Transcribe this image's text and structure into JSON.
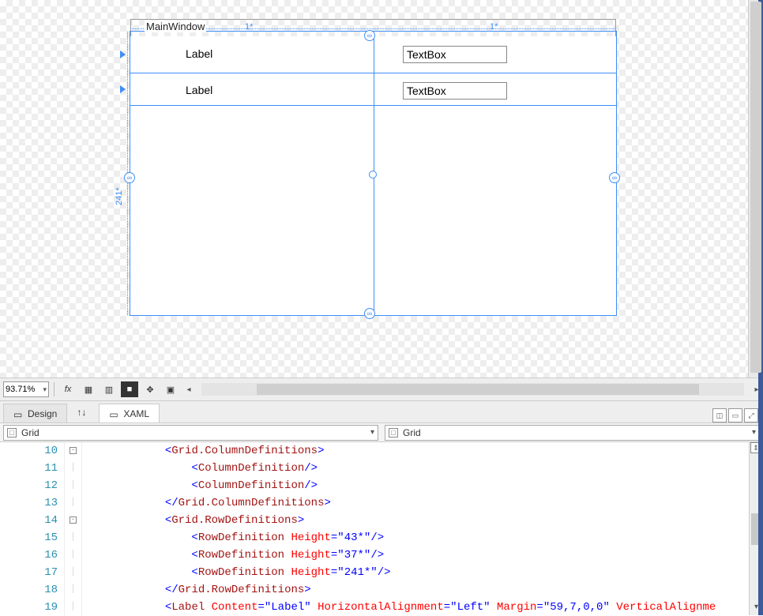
{
  "designer": {
    "window_title": "MainWindow",
    "col_size_0": "1*",
    "col_size_1": "1*",
    "row_size_2": "241*",
    "label0": "Label",
    "label1": "Label",
    "textbox0": "TextBox",
    "textbox1": "TextBox"
  },
  "toolbar": {
    "zoom": "93.71%"
  },
  "tabs": {
    "design": "Design",
    "xaml": "XAML"
  },
  "path": {
    "left": "Grid",
    "right": "Grid"
  },
  "code": {
    "lines": [
      {
        "n": "10",
        "indent": "            ",
        "kind": "open",
        "elem": "Grid.ColumnDefinitions"
      },
      {
        "n": "11",
        "indent": "                ",
        "kind": "self",
        "elem": "ColumnDefinition"
      },
      {
        "n": "12",
        "indent": "                ",
        "kind": "self",
        "elem": "ColumnDefinition"
      },
      {
        "n": "13",
        "indent": "            ",
        "kind": "close",
        "elem": "Grid.ColumnDefinitions"
      },
      {
        "n": "14",
        "indent": "            ",
        "kind": "open",
        "elem": "Grid.RowDefinitions"
      },
      {
        "n": "15",
        "indent": "                ",
        "kind": "selfA",
        "elem": "RowDefinition",
        "attr": "Height",
        "val": "43*"
      },
      {
        "n": "16",
        "indent": "                ",
        "kind": "selfA",
        "elem": "RowDefinition",
        "attr": "Height",
        "val": "37*"
      },
      {
        "n": "17",
        "indent": "                ",
        "kind": "selfA",
        "elem": "RowDefinition",
        "attr": "Height",
        "val": "241*"
      },
      {
        "n": "18",
        "indent": "            ",
        "kind": "close",
        "elem": "Grid.RowDefinitions"
      },
      {
        "n": "19",
        "indent": "            ",
        "kind": "label",
        "elem": "Label",
        "attrs": [
          {
            "name": "Content",
            "val": "Label"
          },
          {
            "name": "HorizontalAlignment",
            "val": "Left"
          },
          {
            "name": "Margin",
            "val": "59,7,0,0"
          }
        ],
        "trailing_attr": "VerticalAlignme"
      }
    ],
    "outline": {
      "10": "-",
      "14": "-"
    }
  }
}
